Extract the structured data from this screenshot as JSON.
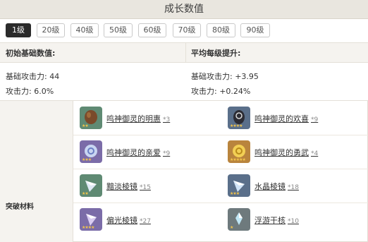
{
  "title": "成长数值",
  "levels": [
    "1级",
    "20级",
    "40级",
    "50级",
    "60级",
    "70级",
    "80级",
    "90级"
  ],
  "active_level": "1级",
  "stats": {
    "base_header": "初始基础数值:",
    "growth_header": "平均每级提升:",
    "base": [
      {
        "label": "基础攻击力:",
        "value": "44"
      },
      {
        "label": "攻击力:",
        "value": "6.0%"
      }
    ],
    "growth": [
      {
        "label": "基础攻击力:",
        "value": "+3.95"
      },
      {
        "label": "攻击力:",
        "value": "+0.24%"
      }
    ]
  },
  "materials": {
    "label": "突破材料",
    "items": [
      {
        "name": "鸣神御灵的明惠",
        "count": "*3",
        "icon": "tanuki-figurine-icon",
        "color": "#5f8a73"
      },
      {
        "name": "鸣神御灵的欢喜",
        "count": "*9",
        "icon": "tanuki-figurine-icon",
        "color": "#5a6f8a"
      },
      {
        "name": "鸣神御灵的亲爱",
        "count": "*9",
        "icon": "tanuki-figurine-icon",
        "color": "#7b6ca8"
      },
      {
        "name": "鸣神御灵的勇武",
        "count": "*4",
        "icon": "tanuki-figurine-icon",
        "color": "#b9843d"
      },
      {
        "name": "黯淡棱镜",
        "count": "*15",
        "icon": "prism-icon",
        "color": "#5f8a73"
      },
      {
        "name": "水晶棱镜",
        "count": "*18",
        "icon": "prism-icon",
        "color": "#5a6f8a"
      },
      {
        "name": "偏光棱镜",
        "count": "*27",
        "icon": "prism-icon",
        "color": "#7b6ca8"
      },
      {
        "name": "浮游干核",
        "count": "*10",
        "icon": "crystal-core-icon",
        "color": "#6e7a7d"
      }
    ]
  }
}
